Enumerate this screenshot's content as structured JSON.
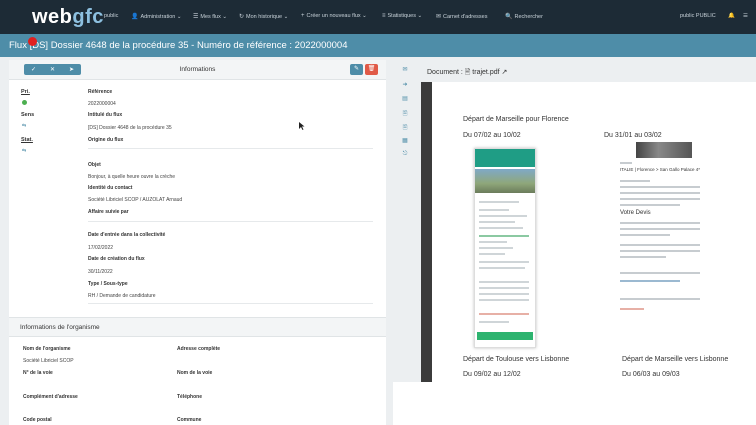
{
  "app": {
    "logo_main": "web",
    "logo_accent": "gfc",
    "nav": [
      {
        "icon": "",
        "label": "public"
      },
      {
        "icon": "👤",
        "label": "Administration ⌄"
      },
      {
        "icon": "☰",
        "label": "Mes flux ⌄"
      },
      {
        "icon": "↻",
        "label": "Mon historique ⌄"
      },
      {
        "icon": "+",
        "label": "Créer un nouveau flux ⌄"
      },
      {
        "icon": "≡",
        "label": "Statistiques ⌄"
      },
      {
        "icon": "✉",
        "label": "Carnet d'adresses"
      },
      {
        "icon": "🔍",
        "label": "Rechercher"
      }
    ],
    "user": "public PUBLIC",
    "bell": "🔔",
    "menu": "☰"
  },
  "titlebar": {
    "title": "Flux [DS] Dossier 4648 de la procédure 35 - Numéro de référence : 2022000004"
  },
  "card": {
    "heading": "Informations",
    "btn_validate": "✓",
    "btn_close": "✕",
    "btn_send": "➤",
    "btn_edit": "✎",
    "btn_delete": "🗑"
  },
  "mini": {
    "pri_label": "Pri.",
    "sens_label": "Sens",
    "sens_value": "⇆",
    "stat_label": "Stat.",
    "stat_value": "⇆"
  },
  "fields": {
    "reference_label": "Référence",
    "reference_value": "2022000004",
    "intitule_label": "Intitulé du flux",
    "intitule_value": "[DS] Dossier 4648 de la procédure 35",
    "origine_label": "Origine du flux",
    "objet_label": "Objet",
    "objet_value": "Bonjour, à quelle heure ouvre la crèche",
    "contact_label": "Identité du contact",
    "contact_value": "Société Libriciel SCOP / AUZOLAT Arnaud",
    "affaire_label": "Affaire suivie par",
    "date_entree_label": "Date d'entrée dans la collectivité",
    "date_entree_value": "17/02/2022",
    "date_creation_label": "Date de création du flux",
    "date_creation_value": "30/11/2022",
    "type_label": "Type / Sous-type",
    "type_value": "RH / Demande de candidature"
  },
  "org": {
    "heading": "Informations de l'organisme",
    "nom_label": "Nom de l'organisme",
    "nom_value": "Société Libriciel SCOP",
    "adresse_label": "Adresse complète",
    "voie_num_label": "N° de la voie",
    "voie_nom_label": "Nom de la voie",
    "complement_label": "Complément d'adresse",
    "telephone_label": "Téléphone",
    "cp_label": "Code postal",
    "commune_label": "Commune"
  },
  "strip_icons": [
    "✉",
    "➜",
    "▤",
    "🗎",
    "🗎",
    "▦",
    "⎋"
  ],
  "document": {
    "label": "Document : 🖹 trajet.pdf ↗",
    "text1": "Départ de Marseille pour  Florence",
    "text2": "Du 07/02 au 10/02",
    "text3": "Du 31/01 au 03/02",
    "text4": "Départ de Toulouse vers Lisbonne",
    "text5": "Départ de Marseille vers Lisbonne",
    "text6": "Du 09/02 au 12/02",
    "text7": "Du 06/03 au 09/03",
    "mini_title": "ITALIE | Florence > San Gallo Palace 4*",
    "mini_heading": "Votre Devis"
  },
  "colors": {
    "nav_bg": "#1d2b36",
    "titlebar_bg": "#4e8da8",
    "accent": "#4e8da8",
    "danger": "#e05a47",
    "record": "#e02020"
  }
}
